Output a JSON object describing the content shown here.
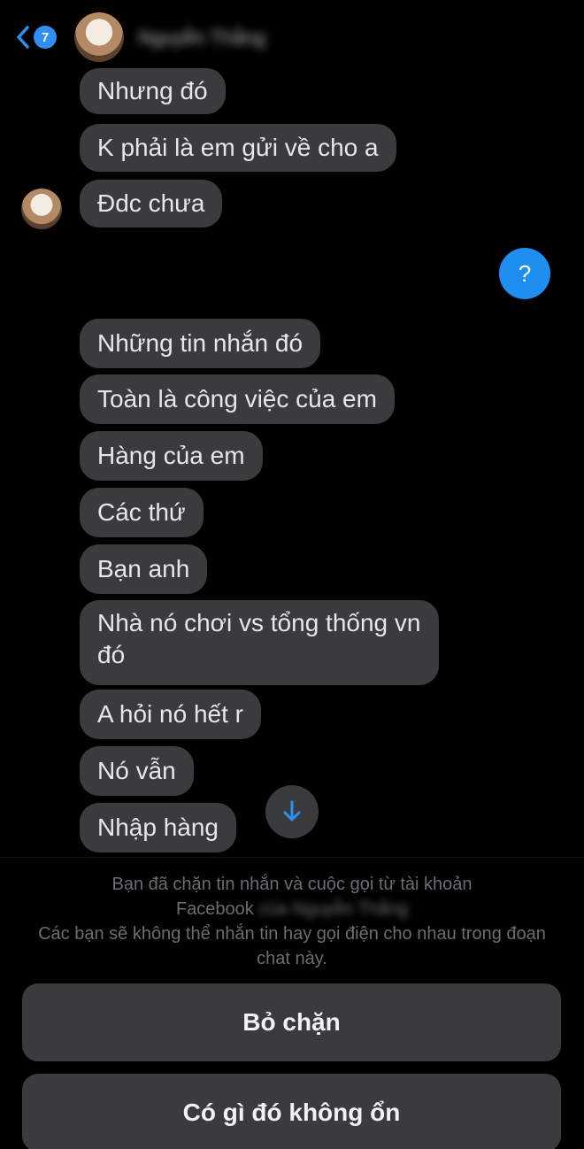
{
  "header": {
    "unread_count": "7",
    "contact_name": "Nguyễn Thắng"
  },
  "messages": [
    {
      "text": "Nhưng đó"
    },
    {
      "text": "K phải là em gửi về cho a"
    },
    {
      "text": "Đdc chưa"
    },
    {
      "text": "Những tin nhắn đó"
    },
    {
      "text": "Toàn là công việc của em"
    },
    {
      "text": "Hàng của em"
    },
    {
      "text": "Các thứ"
    },
    {
      "text": "Bạn anh"
    },
    {
      "text": "Nhà nó chơi vs tổng thống vn đó"
    },
    {
      "text": "A hỏi nó hết r"
    },
    {
      "text": "Nó vẫn"
    },
    {
      "text": "Nhập hàng"
    }
  ],
  "my_message": {
    "text": "?"
  },
  "notice": {
    "line1": "Bạn đã chặn tin nhắn và cuộc gọi từ tài khoản",
    "line2_start": "Facebook",
    "line2_blurred": "của Nguyễn Thắng",
    "line3": "Các bạn sẽ không thể nhắn tin hay gọi điện cho nhau trong đoạn chat này."
  },
  "buttons": {
    "unblock": "Bỏ chặn",
    "report": "Có gì đó không ổn"
  },
  "colors": {
    "background": "#000000",
    "bubble": "#3a3b3d",
    "accent_blue": "#1f8ef1",
    "notice_text": "#6a6d72"
  },
  "icons": {
    "back": "chevron-left-icon",
    "scroll": "arrow-down-icon"
  }
}
